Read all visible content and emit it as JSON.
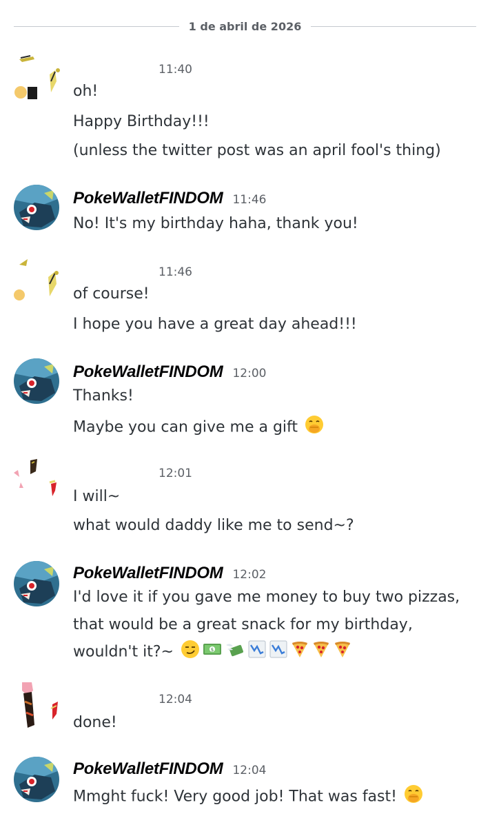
{
  "date_divider": "1 de abril de 2026",
  "messages": [
    {
      "author": "",
      "time": "11:40",
      "lines": [
        "oh!",
        "Happy Birthday!!!",
        "(unless the twitter post was an april fool's thing)"
      ]
    },
    {
      "author": "PokeWalletFINDOM",
      "time": "11:46",
      "lines": [
        "No! It's my birthday haha, thank you!"
      ]
    },
    {
      "author": "",
      "time": "11:46",
      "lines": [
        "of course!",
        "I hope you have a great day ahead!!!"
      ]
    },
    {
      "author": "PokeWalletFINDOM",
      "time": "12:00",
      "lines": [
        "Thanks!",
        "Maybe you can give me a gift"
      ],
      "emoji_line2": [
        "face-with-hand-over-mouth"
      ]
    },
    {
      "author": "",
      "time": "12:01",
      "lines": [
        "I will~",
        "what would daddy like me to send~?"
      ]
    },
    {
      "author": "PokeWalletFINDOM",
      "time": "12:02",
      "lines": [
        "I'd love it if you gave me money to buy two pizzas,",
        "that would be a great snack for my birthday,",
        "wouldn't it?~"
      ],
      "emoji_line3": [
        "smirking-face",
        "money-bills",
        "money-with-wings",
        "chart-decreasing",
        "chart-decreasing",
        "pizza",
        "pizza",
        "pizza"
      ]
    },
    {
      "author": "",
      "time": "12:04",
      "lines": [
        "done!"
      ]
    },
    {
      "author": "PokeWalletFINDOM",
      "time": "12:04",
      "lines": [
        "Mmght fuck! Very good job! That was fast!"
      ],
      "emoji_line1": [
        "face-with-hand-over-mouth"
      ]
    }
  ],
  "colors": {
    "text": "#2e3338",
    "username": "#060607",
    "timestamp": "#5c6066",
    "divider": "#c4c9ce",
    "avatar_bg": "#2f6f8f"
  }
}
